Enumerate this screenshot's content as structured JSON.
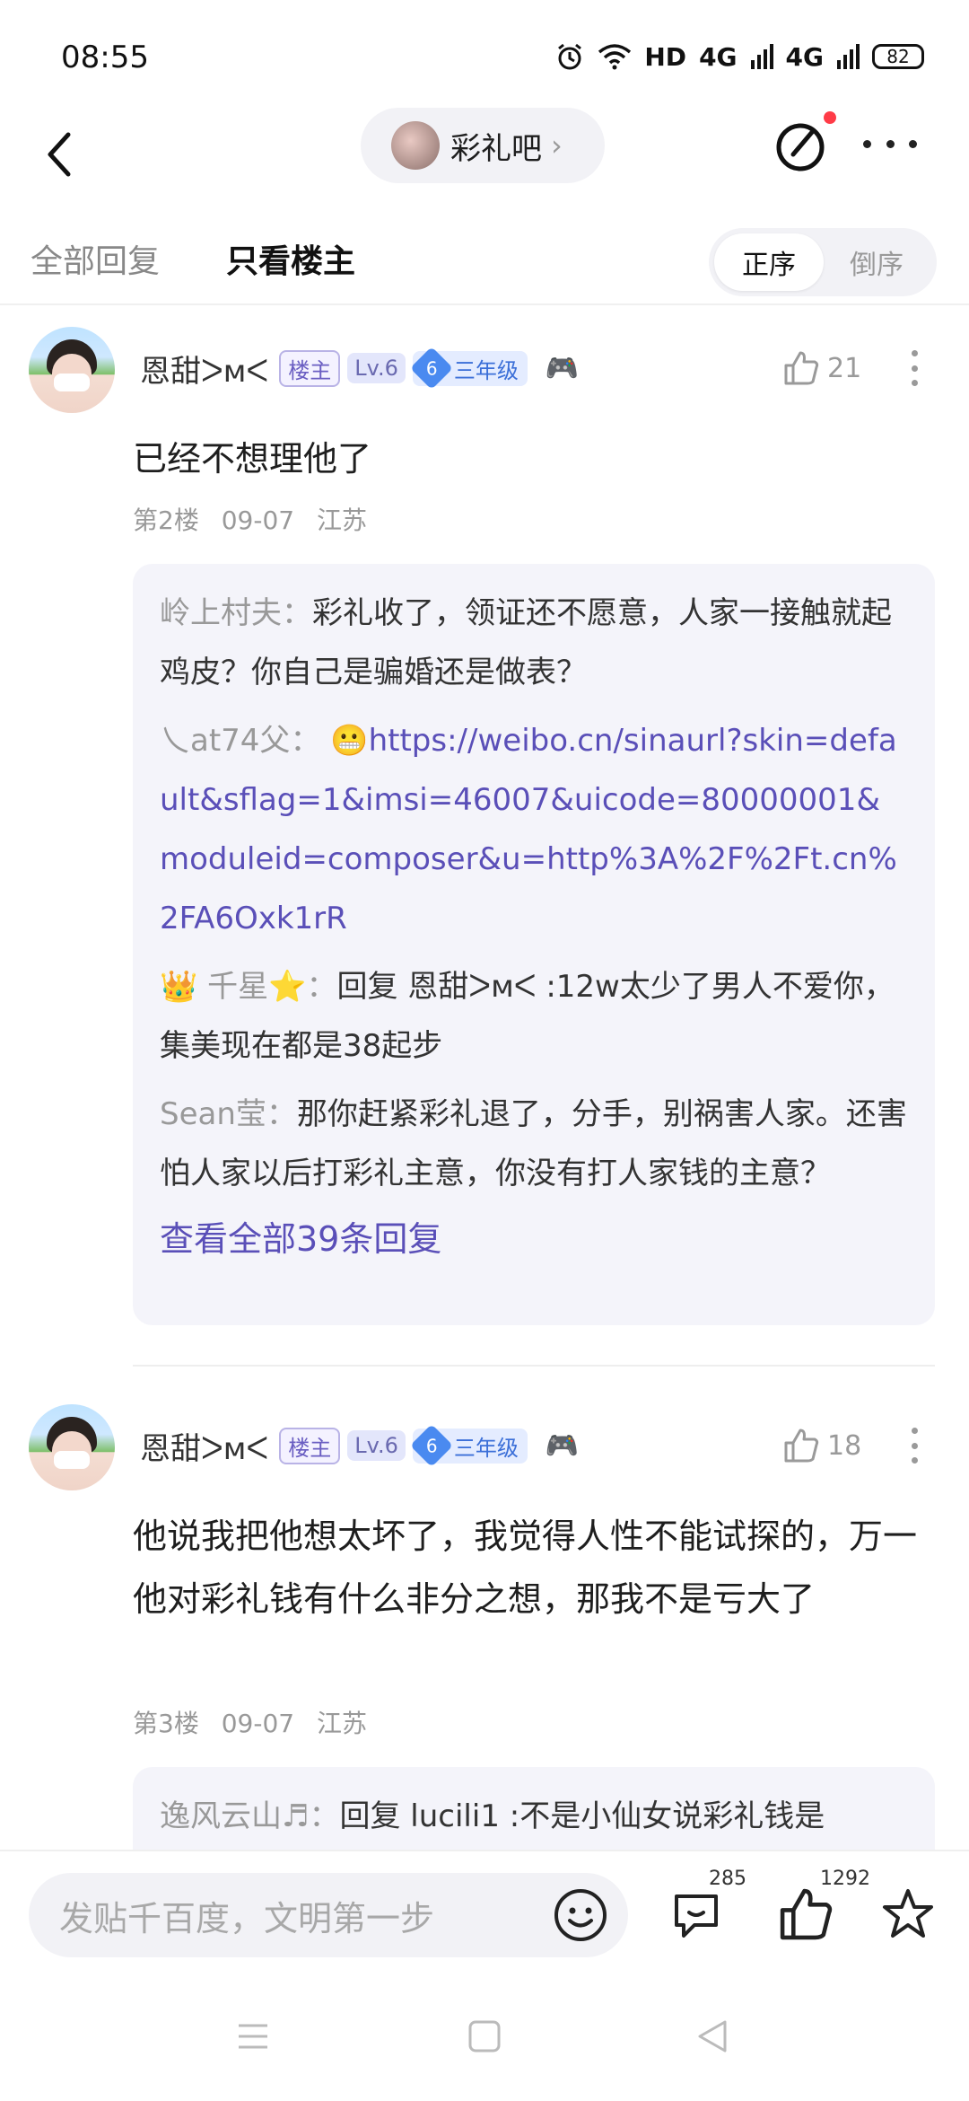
{
  "status_bar": {
    "time": "08:55",
    "network": "HD",
    "sig1": "4G",
    "sig2": "4G",
    "battery": "82"
  },
  "nav": {
    "forum_name": "彩礼吧"
  },
  "tabs": {
    "all": "全部回复",
    "op_only": "只看楼主",
    "sort_asc": "正序",
    "sort_desc": "倒序"
  },
  "posts": [
    {
      "username": "恩甜ᐳᴍᐸ",
      "badge_op": "楼主",
      "badge_level": "Lv.6",
      "grade_num": "6",
      "grade_label": "三年级",
      "likes": "21",
      "content": "已经不想理他了",
      "floor": "第2楼",
      "date": "09-07",
      "location": "江苏",
      "replies": [
        {
          "name": "岭上村夫",
          "text": "彩礼收了，领证还不愿意，人家一接触就起鸡皮？你自己是骗婚还是做表？"
        },
        {
          "name": "乀at74父",
          "emoji": "😬",
          "link": "https://weibo.cn/sinaurl?skin=default&sflag=1&imsi=46007&uicode=80000001&moduleid=composer&u=http%3A%2F%2Ft.cn%2FA6Oxk1rR"
        },
        {
          "name": "👑 千星⭐",
          "text": "回复 恩甜ᐳᴍᐸ :12w太少了男人不爱你，集美现在都是38起步"
        },
        {
          "name": "Sean莹",
          "text": "那你赶紧彩礼退了，分手，别祸害人家。还害怕人家以后打彩礼主意，你没有打人家钱的主意？"
        }
      ],
      "view_all": "查看全部39条回复"
    },
    {
      "username": "恩甜ᐳᴍᐸ",
      "badge_op": "楼主",
      "badge_level": "Lv.6",
      "grade_num": "6",
      "grade_label": "三年级",
      "likes": "18",
      "content": "他说我把他想太坏了，我觉得人性不能试探的，万一他对彩礼钱有什么非分之想，那我不是亏大了",
      "floor": "第3楼",
      "date": "09-07",
      "location": "江苏",
      "replies": [
        {
          "name": "逸风云山♬",
          "text": "回复 lucili1 :不是小仙女说彩礼钱是"
        }
      ]
    }
  ],
  "bottom": {
    "compose_placeholder": "发贴千百度，文明第一步",
    "comments": "285",
    "likes": "1292"
  }
}
